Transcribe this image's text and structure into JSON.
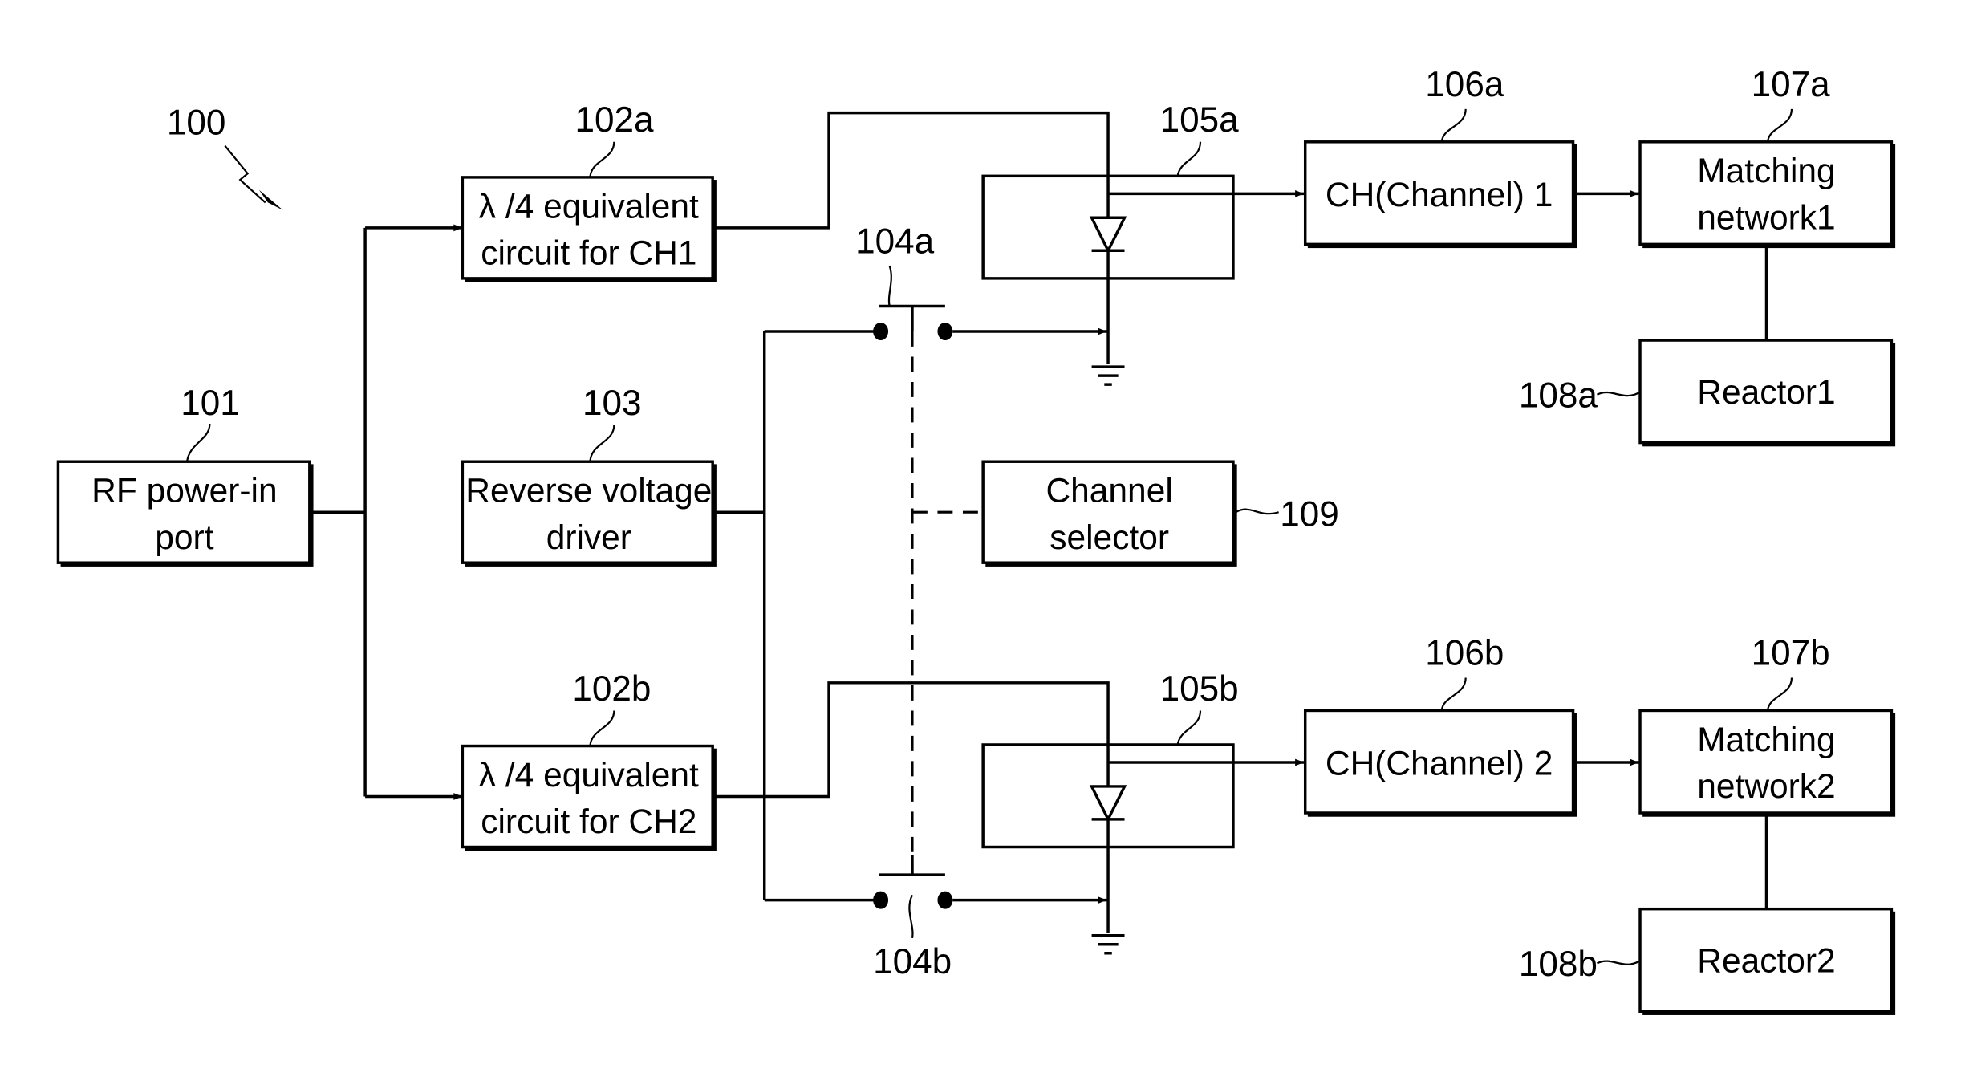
{
  "figure_ref": "100",
  "blocks": {
    "rf_in": {
      "ref": "101",
      "lines": [
        "RF power-in",
        "port"
      ]
    },
    "qw1": {
      "ref": "102a",
      "lines": [
        "λ /4 equivalent",
        "circuit for CH1"
      ]
    },
    "qw2": {
      "ref": "102b",
      "lines": [
        "λ /4 equivalent",
        "circuit for CH2"
      ]
    },
    "rev": {
      "ref": "103",
      "lines": [
        "Reverse voltage",
        "driver"
      ]
    },
    "sw1": {
      "ref": "104a"
    },
    "sw2": {
      "ref": "104b"
    },
    "diode1": {
      "ref": "105a"
    },
    "diode2": {
      "ref": "105b"
    },
    "ch1": {
      "ref": "106a",
      "lines": [
        "CH(Channel) 1"
      ]
    },
    "ch2": {
      "ref": "106b",
      "lines": [
        "CH(Channel) 2"
      ]
    },
    "mn1": {
      "ref": "107a",
      "lines": [
        "Matching",
        "network1"
      ]
    },
    "mn2": {
      "ref": "107b",
      "lines": [
        "Matching",
        "network2"
      ]
    },
    "r1": {
      "ref": "108a",
      "lines": [
        "Reactor1"
      ]
    },
    "r2": {
      "ref": "108b",
      "lines": [
        "Reactor2"
      ]
    },
    "sel": {
      "ref": "109",
      "lines": [
        "Channel",
        "selector"
      ]
    }
  }
}
